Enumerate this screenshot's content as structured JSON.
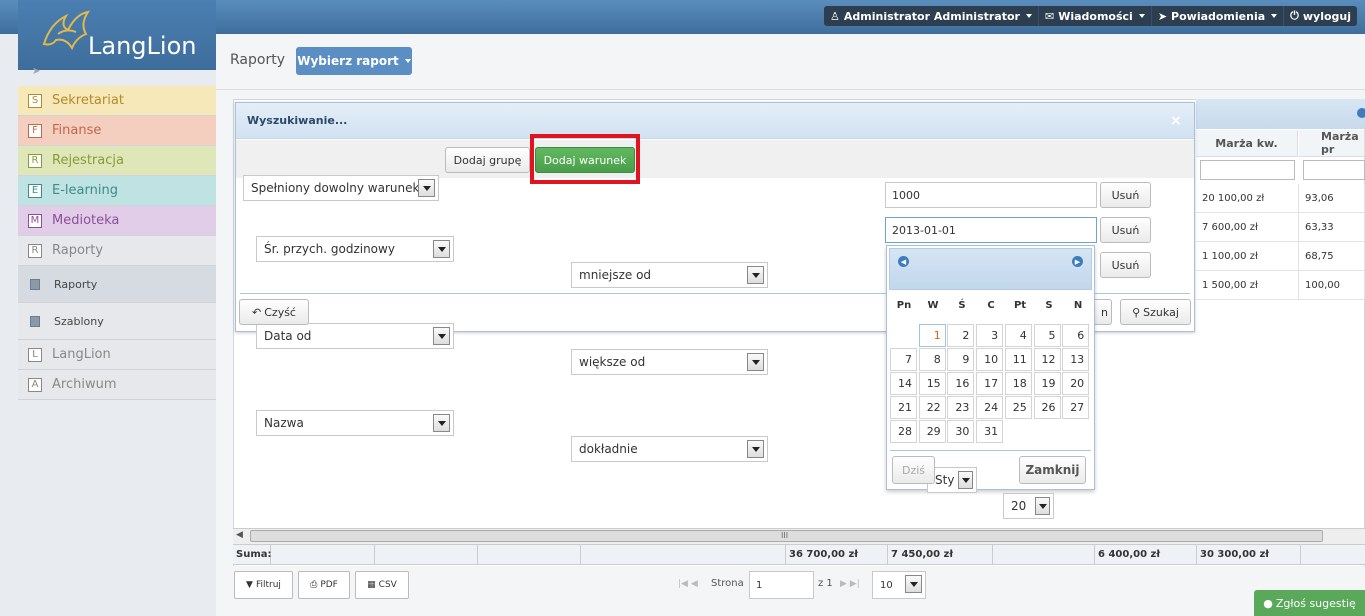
{
  "topmenu": {
    "user": "Administrator Administrator",
    "messages": "Wiadomości",
    "notifications": "Powiadomienia",
    "logout": "wyloguj"
  },
  "logo": "LangLion",
  "sidebar": {
    "items": [
      {
        "letter": "S",
        "label": "Sekretariat",
        "color": "#f6e8b8",
        "text": "#b48a2a"
      },
      {
        "letter": "F",
        "label": "Finanse",
        "color": "#f4cfc0",
        "text": "#c0684a"
      },
      {
        "letter": "R",
        "label": "Rejestracja",
        "color": "#dfe6b8",
        "text": "#8a9a3a"
      },
      {
        "letter": "E",
        "label": "E-learning",
        "color": "#bfe3e3",
        "text": "#3b8c8c"
      },
      {
        "letter": "M",
        "label": "Medioteka",
        "color": "#e2cde9",
        "text": "#8c4e9c"
      },
      {
        "letter": "R",
        "label": "Raporty",
        "color": "#e6e8eb",
        "text": "#888"
      }
    ],
    "subitems": [
      "Raporty",
      "Szablony"
    ],
    "items2": [
      {
        "letter": "L",
        "label": "LangLion"
      },
      {
        "letter": "A",
        "label": "Archiwum"
      }
    ]
  },
  "header": {
    "title": "Raporty",
    "choose_report": "Wybierz raport"
  },
  "grid": {
    "columns": [
      "Marża kw.",
      "Marża pr"
    ],
    "rows": [
      [
        "20 100,00 zł",
        "93,06"
      ],
      [
        "7 600,00 zł",
        "63,33"
      ],
      [
        "1 100,00 zł",
        "68,75"
      ],
      [
        "1 500,00 zł",
        "100,00"
      ]
    ],
    "sum_label": "Suma:",
    "sums": [
      "36 700,00 zł",
      "7 450,00 zł",
      "6 400,00 zł",
      "30 300,00 zł"
    ],
    "scroll_glyph": "III"
  },
  "dialog": {
    "title": "Wyszukiwanie...",
    "mode": "Spełniony dowolny warunek",
    "add_group": "Dodaj grupę",
    "add_condition": "Dodaj warunek",
    "conditions": [
      {
        "field": "Śr. przych. godzinowy",
        "op": "mniejsze od",
        "value": "1000",
        "remove": "Usuń"
      },
      {
        "field": "Data od",
        "op": "większe od",
        "value": "2013-01-01",
        "remove": "Usuń"
      },
      {
        "field": "Nazwa",
        "op": "dokładnie",
        "value": "",
        "remove": "Usuń"
      }
    ],
    "clear": "Czyść",
    "search": "Szukaj",
    "hidden_btn_tail": "n"
  },
  "calendar": {
    "month": "Sty",
    "year": "20",
    "day_names": [
      "Pn",
      "W",
      "Ś",
      "C",
      "Pt",
      "S",
      "N"
    ],
    "today": "Dziś",
    "close": "Zamknij",
    "selected_day": "1"
  },
  "pager": {
    "filter": "Filtruj",
    "pdf": "PDF",
    "csv": "CSV",
    "page_label": "Strona",
    "page": "1",
    "of": "z 1",
    "per_page": "10"
  },
  "feedback": "Zgłoś sugestię"
}
